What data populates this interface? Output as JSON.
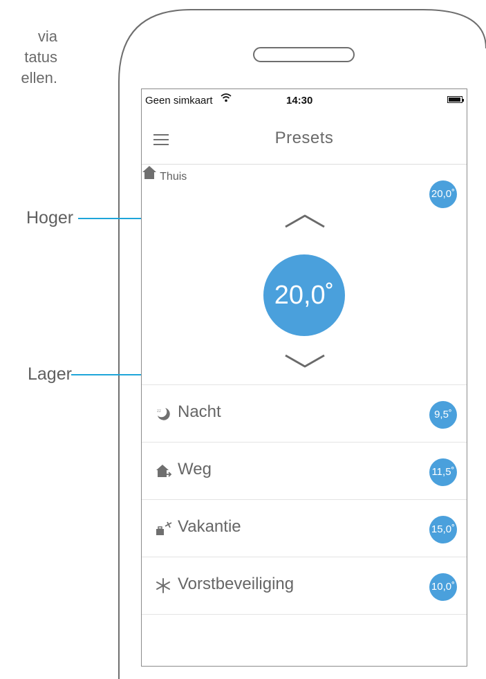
{
  "side_text": [
    "via",
    "tatus",
    "ellen."
  ],
  "callouts": {
    "higher": "Hoger",
    "lower": "Lager"
  },
  "status_bar": {
    "carrier": "Geen simkaart",
    "time": "14:30"
  },
  "nav": {
    "title": "Presets",
    "menu_icon": "hamburger-icon"
  },
  "selected_preset": {
    "label": "Thuis",
    "icon": "home-icon",
    "badge": "20,0˚",
    "value": "20,0˚"
  },
  "presets": [
    {
      "label": "Nacht",
      "icon": "moon-icon",
      "badge": "9,5˚"
    },
    {
      "label": "Weg",
      "icon": "away-icon",
      "badge": "11,5˚"
    },
    {
      "label": "Vakantie",
      "icon": "vacation-icon",
      "badge": "15,0˚"
    },
    {
      "label": "Vorstbeveiliging",
      "icon": "snowflake-icon",
      "badge": "10,0˚"
    }
  ],
  "colors": {
    "accent": "#4aa0dc",
    "callout_line": "#1ea5d9",
    "text": "#666666"
  }
}
